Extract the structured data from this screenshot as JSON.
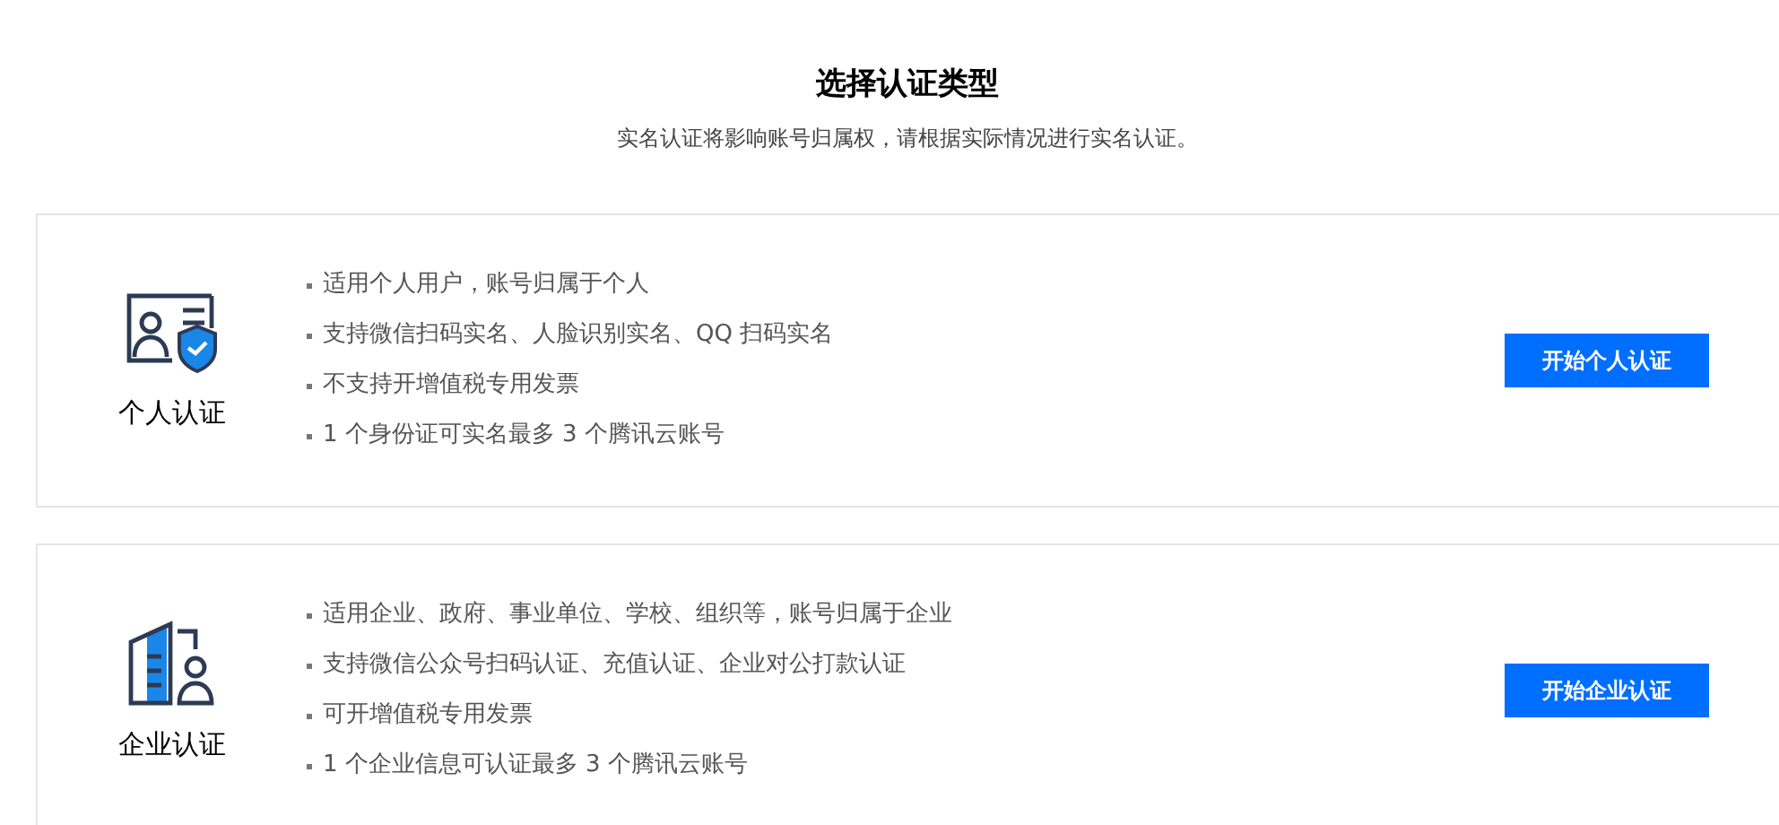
{
  "heading": "选择认证类型",
  "subtitle": "实名认证将影响账号归属权，请根据实际情况进行实名认证。",
  "options": [
    {
      "kind": "person",
      "title": "个人认证",
      "points": [
        "适用个人用户，账号归属于个人",
        "支持微信扫码实名、人脸识别实名、QQ 扫码实名",
        "不支持开增值税专用发票",
        "1 个身份证可实名最多 3 个腾讯云账号"
      ],
      "button": "开始个人认证"
    },
    {
      "kind": "building",
      "title": "企业认证",
      "points": [
        "适用企业、政府、事业单位、学校、组织等，账号归属于企业",
        "支持微信公众号扫码认证、充值认证、企业对公打款认证",
        "可开增值税专用发票",
        "1 个企业信息可认证最多 3 个腾讯云账号"
      ],
      "button": "开始企业认证"
    }
  ]
}
